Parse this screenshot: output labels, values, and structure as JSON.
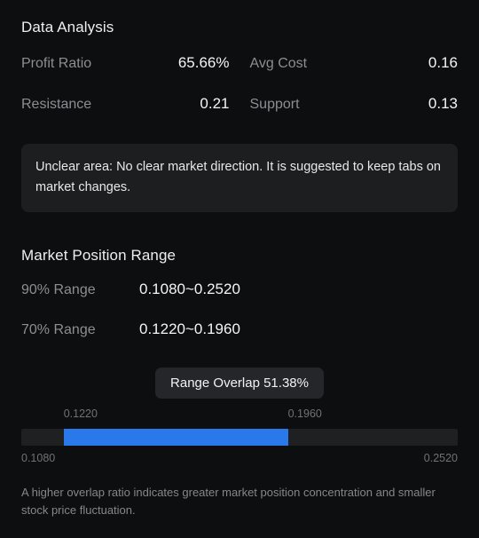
{
  "data_analysis": {
    "title": "Data Analysis",
    "stats": [
      {
        "label": "Profit Ratio",
        "value": "65.66%"
      },
      {
        "label": "Avg Cost",
        "value": "0.16"
      },
      {
        "label": "Resistance",
        "value": "0.21"
      },
      {
        "label": "Support",
        "value": "0.13"
      }
    ],
    "notice": "Unclear area: No clear market direction.  It is suggested to keep tabs on market changes."
  },
  "market_position": {
    "title": "Market Position Range",
    "ranges": [
      {
        "label": "90% Range",
        "value": "0.1080~0.2520"
      },
      {
        "label": "70% Range",
        "value": "0.1220~0.1960"
      }
    ],
    "overlap_badge": "Range Overlap 51.38%",
    "footer_note": "A higher overlap ratio indicates greater market position concentration and smaller stock price fluctuation."
  },
  "chart_data": {
    "type": "bar",
    "title": "Range Overlap 51.38%",
    "orientation": "horizontal",
    "axis_min_label": "0.1080",
    "axis_max_label": "0.2520",
    "axis_min": 0.108,
    "axis_max": 0.252,
    "fill_start_label": "0.1220",
    "fill_end_label": "0.1960",
    "fill_start": 0.122,
    "fill_end": 0.196,
    "fill_start_pct": 9.7,
    "fill_end_pct": 61.1,
    "overlap_pct": 51.38,
    "track_color": "#1f2022",
    "fill_color": "#2979eb",
    "grid": false,
    "legend": "none"
  }
}
